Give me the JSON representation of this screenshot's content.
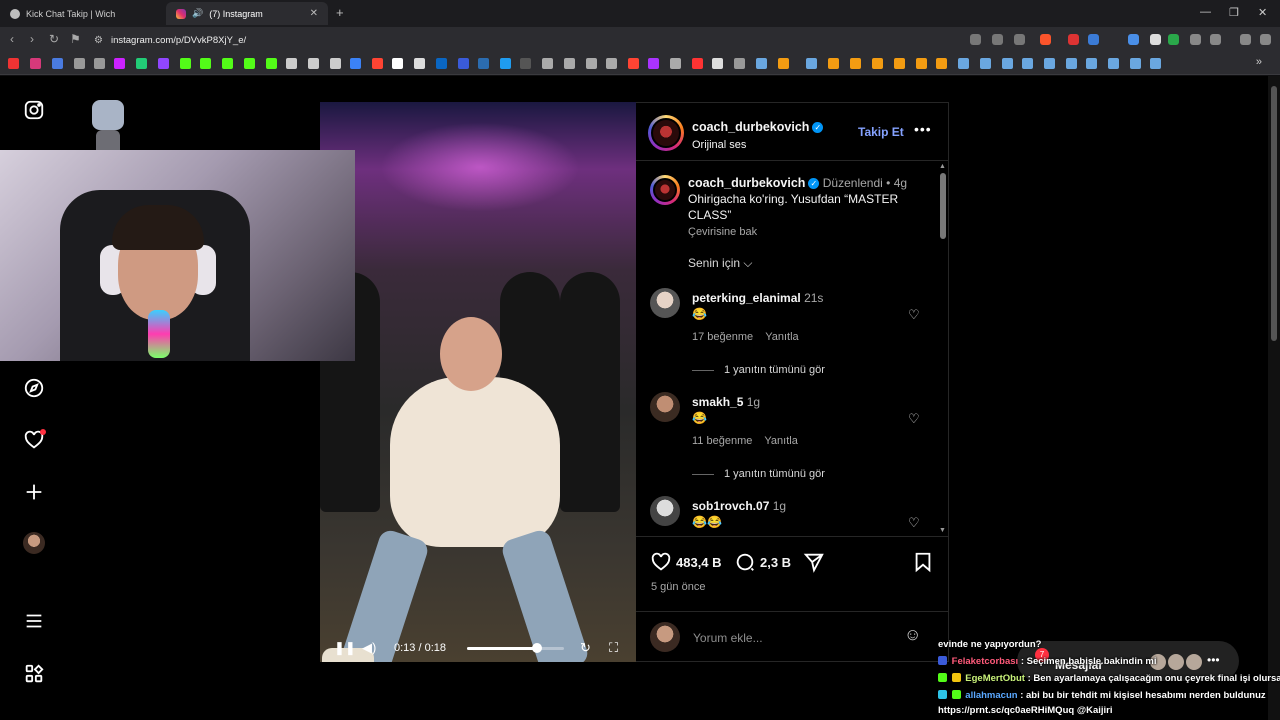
{
  "browser": {
    "tabs": [
      {
        "label": "Kick Chat Takip | Wich"
      },
      {
        "label": "(7) Instagram"
      }
    ],
    "url": "instagram.com/p/DVvkP8XjY_e/"
  },
  "post": {
    "author": "coach_durbekovich",
    "audio": "Orijinal ses",
    "follow_label": "Takip Et",
    "caption": {
      "edited": "Düzenlendi",
      "age": "4g",
      "text": "Ohirigacha ko'ring. Yusufdan “MASTER CLASS”",
      "translate": "Çevirisine bak"
    },
    "sort_label": "Senin için",
    "comments": [
      {
        "user": "peterking_elanimal",
        "age": "21s",
        "text": "😂",
        "likes": "17 beğenme",
        "reply": "Yanıtla",
        "view_replies": "1 yanıtın tümünü gör"
      },
      {
        "user": "smakh_5",
        "age": "1g",
        "text": "😂",
        "likes": "11 beğenme",
        "reply": "Yanıtla",
        "view_replies": "1 yanıtın tümünü gör"
      },
      {
        "user": "sob1rovch.07",
        "age": "1g",
        "text": "😂😂"
      }
    ],
    "likes": "483,4 B",
    "comment_count": "2,3 B",
    "posted": "5 gün önce",
    "add_comment_placeholder": "Yorum ekle...",
    "video": {
      "time": "0:13 / 0:18",
      "progress": 0.72
    }
  },
  "messages": {
    "label": "Mesajlar",
    "count": "7"
  },
  "stream_chat": [
    {
      "user": "",
      "text": "evinde ne yapıyordun?"
    },
    {
      "user": "Felaketcorbası",
      "text": ": Seçimen babişle bakindin mi"
    },
    {
      "user": "EgeMertObut",
      "text": ": Ben ayarlamaya çalışacağım onu çeyrek final işi olursa"
    },
    {
      "user": "allahmacun",
      "text": ": abi bu bir tehdit mi kişisel hesabımı nerden buldunuz"
    },
    {
      "user": "",
      "text": "https://prnt.sc/qc0aeRHiMQuq @Kaijiri"
    }
  ],
  "colors": {
    "accent": "#0095f6",
    "follow": "#85a2ff",
    "notification": "#ff3040"
  }
}
